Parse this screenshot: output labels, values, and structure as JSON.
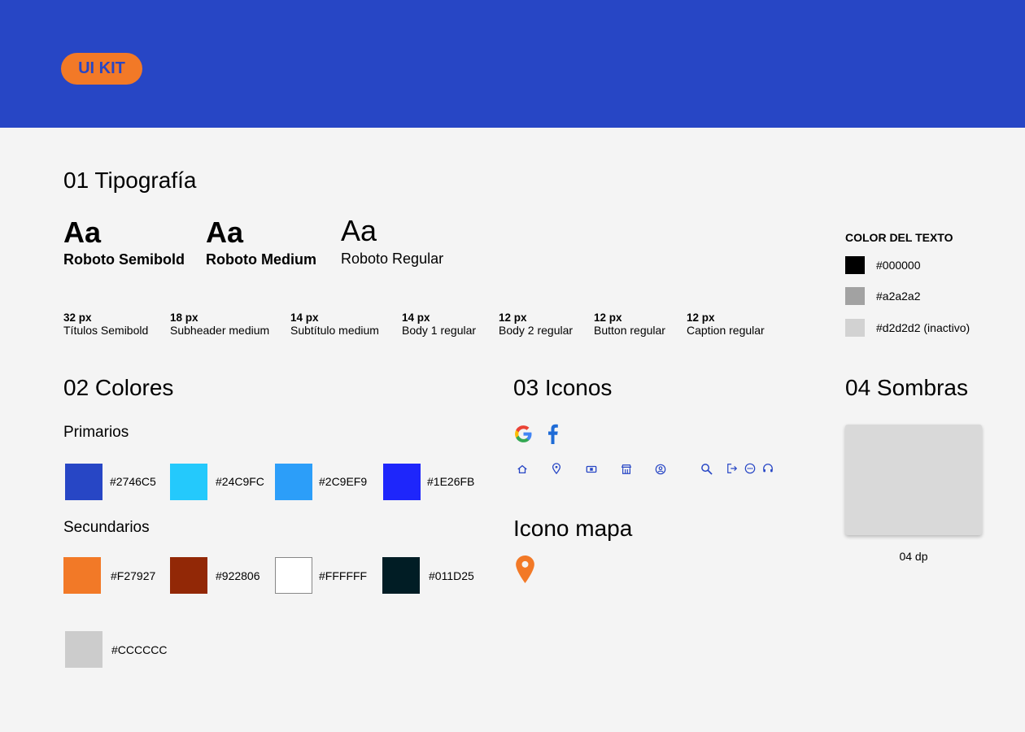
{
  "header": {
    "badge": "UI KIT",
    "bg_color": "#2746C5",
    "badge_color": "#F27927"
  },
  "typography": {
    "title": "01 Tipografía",
    "fonts": [
      {
        "sample": "Aa",
        "name": "Roboto Semibold"
      },
      {
        "sample": "Aa",
        "name": "Roboto Medium"
      },
      {
        "sample": "Aa",
        "name": "Roboto Regular"
      }
    ],
    "specs": [
      {
        "size": "32 px",
        "name": "Títulos Semibold"
      },
      {
        "size": "18 px",
        "name": "Subheader medium"
      },
      {
        "size": "14 px",
        "name": "Subtítulo medium"
      },
      {
        "size": "14 px",
        "name": "Body 1 regular"
      },
      {
        "size": "12 px",
        "name": "Body 2 regular"
      },
      {
        "size": "12 px",
        "name": "Button regular"
      },
      {
        "size": "12 px",
        "name": "Caption regular"
      }
    ],
    "text_color": {
      "title": "COLOR DEL TEXTO",
      "items": [
        {
          "color": "#000000",
          "label": "#000000"
        },
        {
          "color": "#a2a2a2",
          "label": "#a2a2a2"
        },
        {
          "color": "#d2d2d2",
          "label": "#d2d2d2 (inactivo)"
        }
      ]
    }
  },
  "colors": {
    "title": "02 Colores",
    "primary_title": "Primarios",
    "primary": [
      {
        "color": "#2746C5",
        "label": "#2746C5"
      },
      {
        "color": "#24C9FC",
        "label": "#24C9FC"
      },
      {
        "color": "#2C9EF9",
        "label": "#2C9EF9"
      },
      {
        "color": "#1E26FB",
        "label": "#1E26FB"
      }
    ],
    "secondary_title": "Secundarios",
    "secondary": [
      {
        "color": "#F27927",
        "label": "#F27927"
      },
      {
        "color": "#922806",
        "label": "#922806"
      },
      {
        "color": "#FFFFFF",
        "label": "#FFFFFF"
      },
      {
        "color": "#011D25",
        "label": "#011D25"
      }
    ],
    "extra": [
      {
        "color": "#CCCCCC",
        "label": "#CCCCCC"
      }
    ]
  },
  "icons": {
    "title": "03 Iconos",
    "brand": [
      "google-icon",
      "facebook-icon"
    ],
    "set": [
      "home-icon",
      "location-heart-icon",
      "ticket-icon",
      "store-icon",
      "user-circle-icon",
      "search-icon",
      "logout-icon",
      "chat-icon",
      "support-icon"
    ],
    "icon_color": "#2746C5"
  },
  "map_icon": {
    "title": "Icono mapa",
    "icon": "map-pin-icon",
    "color": "#F27927"
  },
  "shadows": {
    "title": "04 Sombras",
    "caption": "04 dp"
  }
}
